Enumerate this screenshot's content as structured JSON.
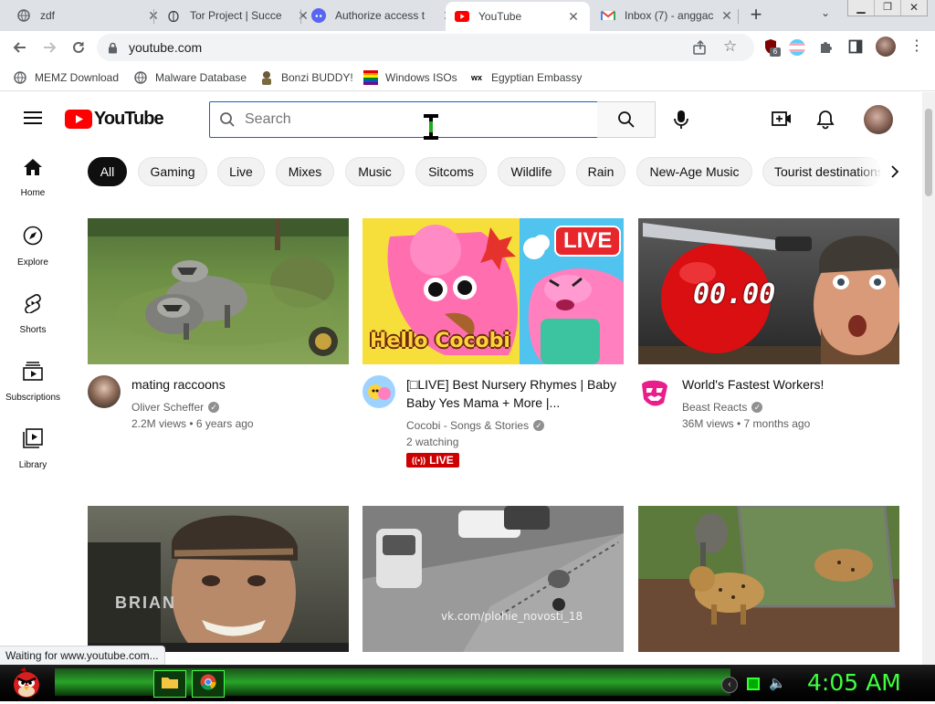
{
  "browser": {
    "tabs": [
      {
        "title": "zdf",
        "icon": "globe-icon"
      },
      {
        "title": "Tor Project | Succe",
        "icon": "tor-onion-icon"
      },
      {
        "title": "Authorize access t",
        "icon": "discord-icon"
      },
      {
        "title": "YouTube",
        "icon": "youtube-icon",
        "active": true
      },
      {
        "title": "Inbox (7) - anggac",
        "icon": "gmail-icon"
      }
    ],
    "url": "youtube.com",
    "extension_badge": "6",
    "bookmarks": [
      {
        "label": "MEMZ Download",
        "icon": "globe-icon"
      },
      {
        "label": "Malware Database",
        "icon": "globe-icon"
      },
      {
        "label": "Bonzi BUDDY!",
        "icon": "bonzi-icon"
      },
      {
        "label": "Windows ISOs",
        "icon": "windows-flag-icon"
      },
      {
        "label": "Egyptian Embassy",
        "icon": "wix-icon"
      }
    ]
  },
  "youtube": {
    "logo_text": "YouTube",
    "search_placeholder": "Search",
    "chips": [
      "All",
      "Gaming",
      "Live",
      "Mixes",
      "Music",
      "Sitcoms",
      "Wildlife",
      "Rain",
      "New-Age Music",
      "Tourist destinations"
    ],
    "sidebar": [
      {
        "label": "Home",
        "icon": "home-icon"
      },
      {
        "label": "Explore",
        "icon": "compass-icon"
      },
      {
        "label": "Shorts",
        "icon": "shorts-icon"
      },
      {
        "label": "Subscriptions",
        "icon": "subscriptions-icon"
      },
      {
        "label": "Library",
        "icon": "library-icon"
      }
    ],
    "videos": [
      {
        "title": "mating raccoons",
        "channel": "Oliver Scheffer",
        "verified": true,
        "stats": "2.2M views • 6 years ago"
      },
      {
        "title": "[□LIVE] Best Nursery Rhymes | Baby Baby Yes Mama + More |...",
        "channel": "Cocobi - Songs & Stories",
        "verified": true,
        "stats": "2 watching",
        "live_label": "LIVE",
        "thumb_brand": "Hello Cocobi",
        "thumb_live": "LIVE"
      },
      {
        "title": "World's Fastest Workers!",
        "channel": "Beast Reacts",
        "verified": true,
        "stats": "36M views • 7 months ago",
        "thumb_text": "00.00"
      },
      {
        "title": "",
        "thumb_text": "BRIAN"
      },
      {
        "title": "",
        "thumb_text": "vk.com/plohie_novosti_18"
      },
      {
        "title": ""
      }
    ]
  },
  "status_text": "Waiting for www.youtube.com...",
  "taskbar": {
    "clock": "4:05 AM"
  },
  "colors": {
    "youtube_red": "#ff0000",
    "taskbar_green": "#3fff3f"
  }
}
